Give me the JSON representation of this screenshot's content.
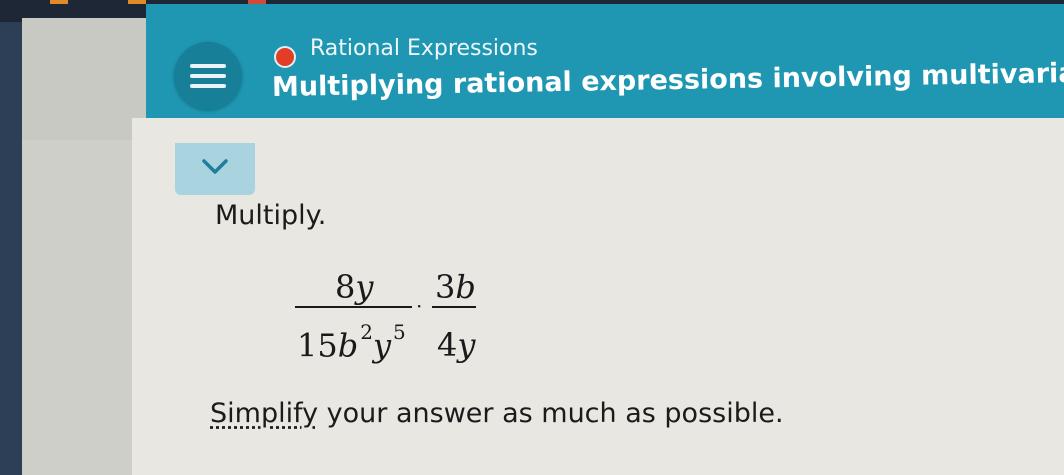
{
  "header": {
    "topic": "Rational Expressions",
    "title": "Multiplying rational expressions involving multivariate monomia",
    "accent_color": "#1f97b3",
    "status_color": "#e23d26",
    "menu_icon": "hamburger-icon"
  },
  "collapse": {
    "icon": "chevron-down-icon"
  },
  "problem": {
    "prompt": "Multiply.",
    "fraction1": {
      "numerator_coef": "8",
      "numerator_var": "y",
      "denominator_coef": "15",
      "denominator_var1": "b",
      "denominator_exp1": "2",
      "denominator_var2": "y",
      "denominator_exp2": "5"
    },
    "operator": "·",
    "fraction2": {
      "numerator_coef": "3",
      "numerator_var": "b",
      "denominator_coef": "4",
      "denominator_var": "y"
    },
    "instruction_link": "Simplify",
    "instruction_rest": " your answer as much as possible."
  }
}
